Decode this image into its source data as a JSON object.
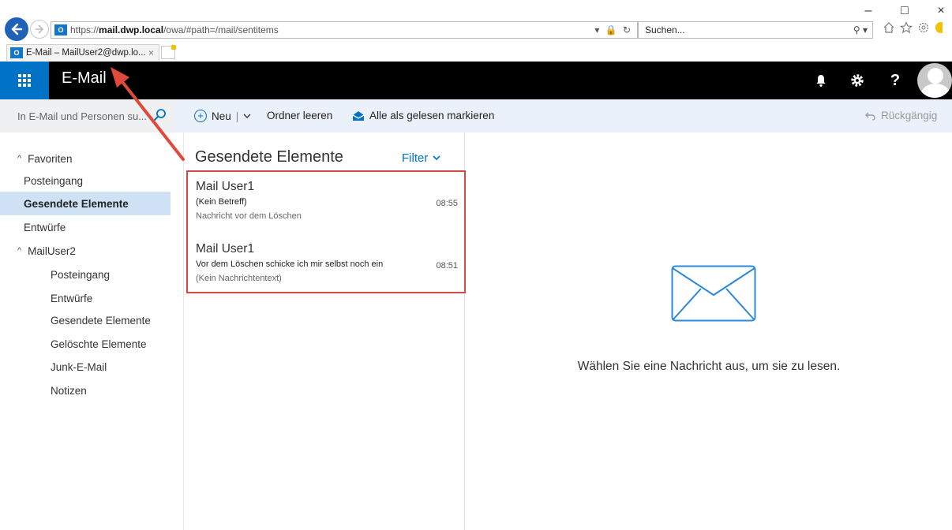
{
  "browser": {
    "url_scheme": "https://",
    "url_host": "mail.dwp.local",
    "url_path": "/owa/#path=/mail/sentitems",
    "url_icons": "▾ 🔒 ↻",
    "search_placeholder": "Suchen...",
    "search_icon": "⚲ ▾",
    "tab_title": "E-Mail – MailUser2@dwp.lo...",
    "tab_close": "×",
    "owa_icon_text": "O",
    "window_minimize": "–",
    "window_maximize": "□",
    "window_close": "×",
    "toolbar_icons": [
      "home-icon",
      "star-icon",
      "gear-icon",
      "smiley-icon"
    ]
  },
  "app": {
    "title": "E-Mail",
    "accent": "#0072c6",
    "top_icons": [
      "bell-icon",
      "gear-icon",
      "help-icon",
      "avatar"
    ],
    "help_label": "?"
  },
  "commandbar": {
    "search_placeholder": "In E-Mail und Personen su...",
    "new_label": "Neu",
    "new_separator": "|",
    "empty_folder_label": "Ordner leeren",
    "mark_all_read_label": "Alle als gelesen markieren",
    "undo_label": "Rückgängig"
  },
  "folders": [
    {
      "label": "Favoriten",
      "level": 0,
      "caret": "^"
    },
    {
      "label": "Posteingang",
      "level": 1
    },
    {
      "label": "Gesendete Elemente",
      "level": 1,
      "selected": true
    },
    {
      "label": "Entwürfe",
      "level": 1
    },
    {
      "label": "MailUser2",
      "level": 0,
      "caret": "^"
    },
    {
      "label": "Posteingang",
      "level": 2
    },
    {
      "label": "Entwürfe",
      "level": 2
    },
    {
      "label": "Gesendete Elemente",
      "level": 2
    },
    {
      "label": "Gelöschte Elemente",
      "level": 2
    },
    {
      "label": "Junk-E-Mail",
      "level": 2
    },
    {
      "label": "Notizen",
      "level": 2
    }
  ],
  "list": {
    "title": "Gesendete Elemente",
    "filter_label": "Filter",
    "messages": [
      {
        "sender": "Mail User1",
        "subject": "(Kein Betreff)",
        "time": "08:55",
        "preview": "Nachricht vor dem Löschen"
      },
      {
        "sender": "Mail User1",
        "subject": "Vor dem Löschen schicke ich mir selbst noch ein",
        "time": "08:51",
        "preview": "(Kein Nachrichtentext)"
      }
    ]
  },
  "reading_pane": {
    "empty_text": "Wählen Sie eine Nachricht aus, um sie zu lesen."
  },
  "annotation": {
    "color": "#e04a3a"
  }
}
